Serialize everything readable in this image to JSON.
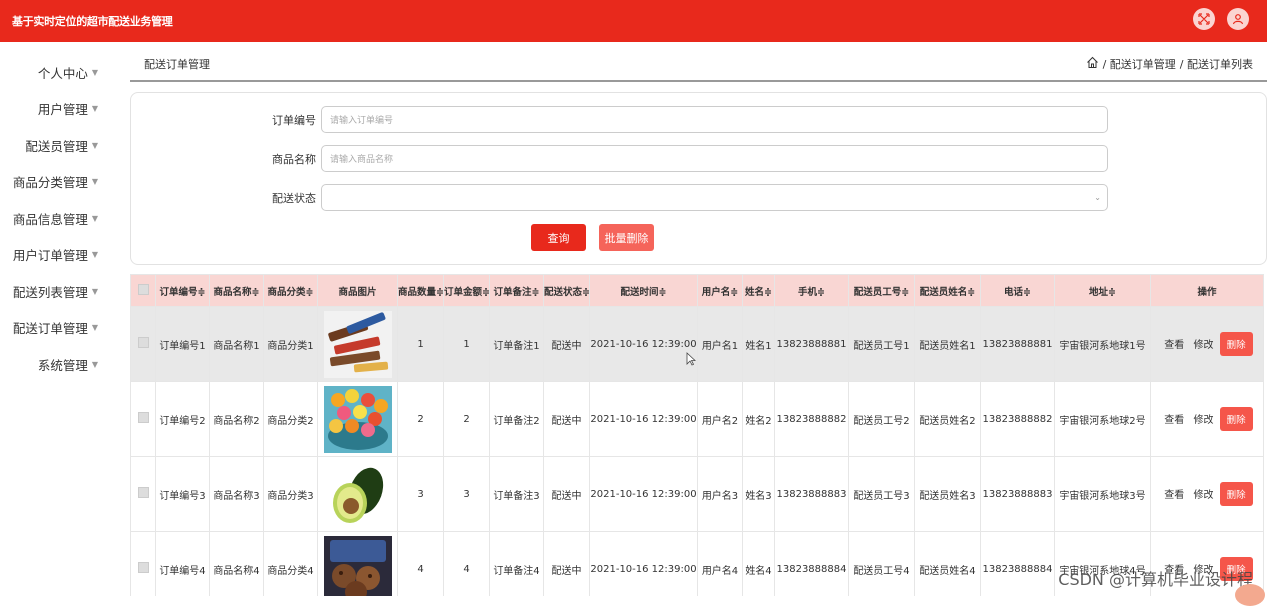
{
  "app": {
    "title": "基于实时定位的超市配送业务管理"
  },
  "sidebar": {
    "items": [
      {
        "label": "个人中心"
      },
      {
        "label": "用户管理"
      },
      {
        "label": "配送员管理"
      },
      {
        "label": "商品分类管理"
      },
      {
        "label": "商品信息管理"
      },
      {
        "label": "用户订单管理"
      },
      {
        "label": "配送列表管理"
      },
      {
        "label": "配送订单管理"
      },
      {
        "label": "系统管理"
      }
    ]
  },
  "header": {
    "page_title": "配送订单管理",
    "breadcrumb": [
      "/ 配送订单管理",
      "/ 配送订单列表"
    ]
  },
  "search": {
    "order_no_label": "订单编号",
    "order_no_placeholder": "请输入订单编号",
    "product_name_label": "商品名称",
    "product_name_placeholder": "请输入商品名称",
    "status_label": "配送状态",
    "query_button": "查询",
    "batch_delete_button": "批量删除"
  },
  "table": {
    "headers": [
      "订单编号≑",
      "商品名称≑",
      "商品分类≑",
      "商品图片",
      "商品数量≑",
      "订单金额≑",
      "订单备注≑",
      "配送状态≑",
      "配送时间≑",
      "用户名≑",
      "姓名≑",
      "手机≑",
      "配送员工号≑",
      "配送员姓名≑",
      "电话≑",
      "地址≑",
      "操作"
    ],
    "actions": {
      "view": "查看",
      "edit": "修改",
      "delete": "删除"
    },
    "rows": [
      {
        "order_no": "订单编号1",
        "product_name": "商品名称1",
        "category": "商品分类1",
        "image": "candy-bars",
        "qty": "1",
        "amount": "1",
        "remark": "订单备注1",
        "status": "配送中",
        "time": "2021-10-16 12:39:00",
        "username": "用户名1",
        "name": "姓名1",
        "phone": "13823888881",
        "courier_no": "配送员工号1",
        "courier_name": "配送员姓名1",
        "tel": "13823888881",
        "address": "宇宙银河系地球1号"
      },
      {
        "order_no": "订单编号2",
        "product_name": "商品名称2",
        "category": "商品分类2",
        "image": "jelly-candy",
        "qty": "2",
        "amount": "2",
        "remark": "订单备注2",
        "status": "配送中",
        "time": "2021-10-16 12:39:00",
        "username": "用户名2",
        "name": "姓名2",
        "phone": "13823888882",
        "courier_no": "配送员工号2",
        "courier_name": "配送员姓名2",
        "tel": "13823888882",
        "address": "宇宙银河系地球2号"
      },
      {
        "order_no": "订单编号3",
        "product_name": "商品名称3",
        "category": "商品分类3",
        "image": "avocado",
        "qty": "3",
        "amount": "3",
        "remark": "订单备注3",
        "status": "配送中",
        "time": "2021-10-16 12:39:00",
        "username": "用户名3",
        "name": "姓名3",
        "phone": "13823888883",
        "courier_no": "配送员工号3",
        "courier_name": "配送员姓名3",
        "tel": "13823888883",
        "address": "宇宙银河系地球3号"
      },
      {
        "order_no": "订单编号4",
        "product_name": "商品名称4",
        "category": "商品分类4",
        "image": "cookies",
        "qty": "4",
        "amount": "4",
        "remark": "订单备注4",
        "status": "配送中",
        "time": "2021-10-16 12:39:00",
        "username": "用户名4",
        "name": "姓名4",
        "phone": "13823888884",
        "courier_no": "配送员工号4",
        "courier_name": "配送员姓名4",
        "tel": "13823888884",
        "address": "宇宙银河系地球4号"
      }
    ]
  },
  "watermark": "CSDN @计算机毕业设计程",
  "colors": {
    "brand": "#e8291c",
    "header_row": "#f9d6d3",
    "delete": "#f5564a"
  }
}
